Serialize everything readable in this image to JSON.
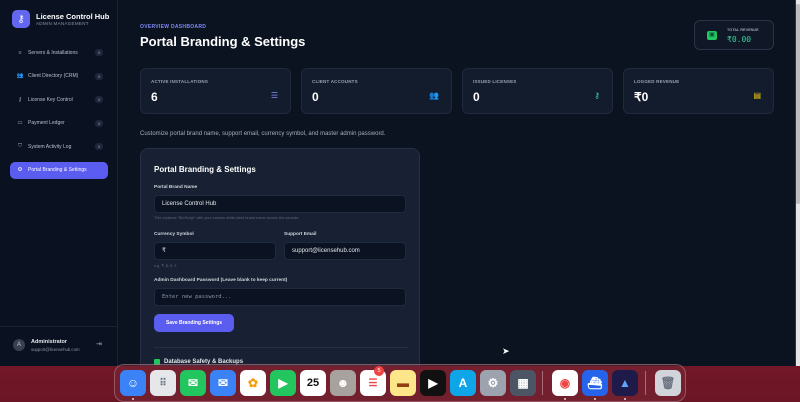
{
  "sidebar": {
    "brand_title": "License Control Hub",
    "brand_subtitle": "ADMIN MANAGEMENT",
    "items": [
      {
        "label": "Servers & Installations",
        "count": "0",
        "icon": "server-icon"
      },
      {
        "label": "Client Directory (CRM)",
        "count": "0",
        "icon": "users-icon"
      },
      {
        "label": "License Key Control",
        "count": "0",
        "icon": "key-icon"
      },
      {
        "label": "Payment Ledger",
        "count": "0",
        "icon": "ledger-icon"
      },
      {
        "label": "System Activity Log",
        "count": "0",
        "icon": "shield-icon"
      },
      {
        "label": "Portal Branding & Settings",
        "icon": "gear-icon",
        "active": true
      }
    ],
    "user_name": "Administrator",
    "user_email": "support@licensehub.com",
    "avatar_initial": "A"
  },
  "header": {
    "eyebrow": "OVERVIEW DASHBOARD",
    "title": "Portal Branding & Settings",
    "revenue_label": "TOTAL REVENUE",
    "revenue_value": "₹0.00"
  },
  "stats": [
    {
      "label": "ACTIVE INSTALLATIONS",
      "value": "6",
      "icon": "server-stack-icon",
      "color": "#818cf8"
    },
    {
      "label": "CLIENT ACCOUNTS",
      "value": "0",
      "icon": "users-icon",
      "color": "#a78bfa"
    },
    {
      "label": "ISSUED LICENSES",
      "value": "0",
      "icon": "key-icon",
      "color": "#34d399"
    },
    {
      "label": "LOGGED REVENUE",
      "value": "₹0",
      "icon": "receipt-icon",
      "color": "#facc15"
    }
  ],
  "description": "Customize portal brand name, support email, currency symbol, and master admin password.",
  "form": {
    "title": "Portal Branding & Settings",
    "brand_name_label": "Portal Brand Name",
    "brand_name_value": "License Control Hub",
    "brand_name_hint": "This replaces \"BioScript\" with your custom white-label brand name across the console.",
    "currency_label": "Currency Symbol",
    "currency_value": "₹",
    "currency_hint": "e.g. ₹, $, €, £",
    "support_email_label": "Support Email",
    "support_email_value": "support@licensehub.com",
    "password_label": "Admin Dashboard Password (Leave blank to keep current)",
    "password_placeholder": "Enter new password...",
    "save_label": "Save Branding Settings",
    "next_section_title": "Database Safety & Backups"
  },
  "dock": {
    "calendar_day": "25",
    "reminders_badge": "5",
    "apps": [
      "Finder",
      "Launchpad",
      "Messages",
      "Mail",
      "Photos",
      "FaceTime",
      "Calendar",
      "Contacts",
      "Reminders",
      "Notes",
      "TV",
      "App Store",
      "System Settings",
      "Calculator",
      "Chrome",
      "Docker",
      "Affinity",
      "Trash"
    ]
  }
}
